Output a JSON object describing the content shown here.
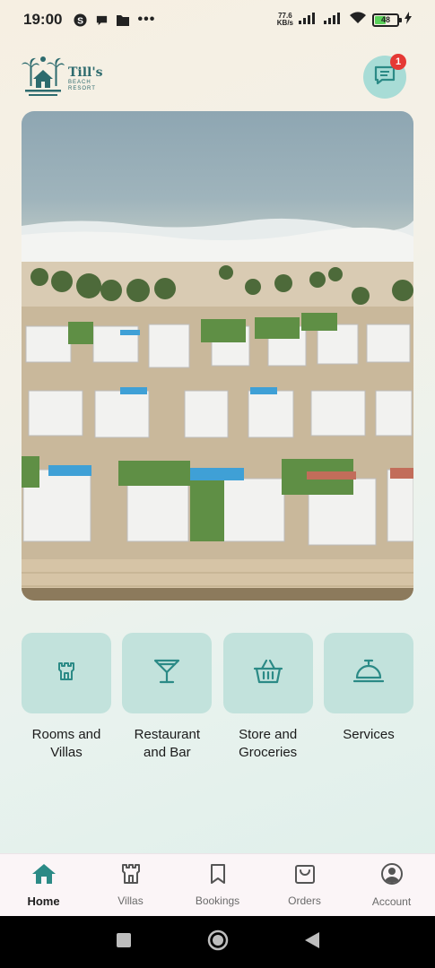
{
  "status_bar": {
    "time": "19:00",
    "net_speed_value": "77.6",
    "net_speed_unit": "KB/s",
    "battery_level": "48",
    "battery_fraction": 0.48
  },
  "header": {
    "logo_title": "Till's",
    "logo_line1": "BEACH",
    "logo_line2": "RESORT",
    "chat_badge": "1"
  },
  "categories": [
    {
      "label_line1": "Rooms and",
      "label_line2": "Villas",
      "icon": "castle-icon"
    },
    {
      "label_line1": "Restaurant",
      "label_line2": "and Bar",
      "icon": "cocktail-icon"
    },
    {
      "label_line1": "Store and",
      "label_line2": "Groceries",
      "icon": "basket-icon"
    },
    {
      "label_line1": "Services",
      "label_line2": "",
      "icon": "service-bell-icon"
    }
  ],
  "bottom_nav": [
    {
      "label": "Home",
      "icon": "home-icon",
      "active": true
    },
    {
      "label": "Villas",
      "icon": "castle-icon",
      "active": false
    },
    {
      "label": "Bookings",
      "icon": "bookmark-icon",
      "active": false
    },
    {
      "label": "Orders",
      "icon": "shopping-bag-icon",
      "active": false
    },
    {
      "label": "Account",
      "icon": "account-icon",
      "active": false
    }
  ],
  "colors": {
    "accent": "#2b8a86",
    "tile_background": "#c2e2dc",
    "badge": "#e53935"
  }
}
